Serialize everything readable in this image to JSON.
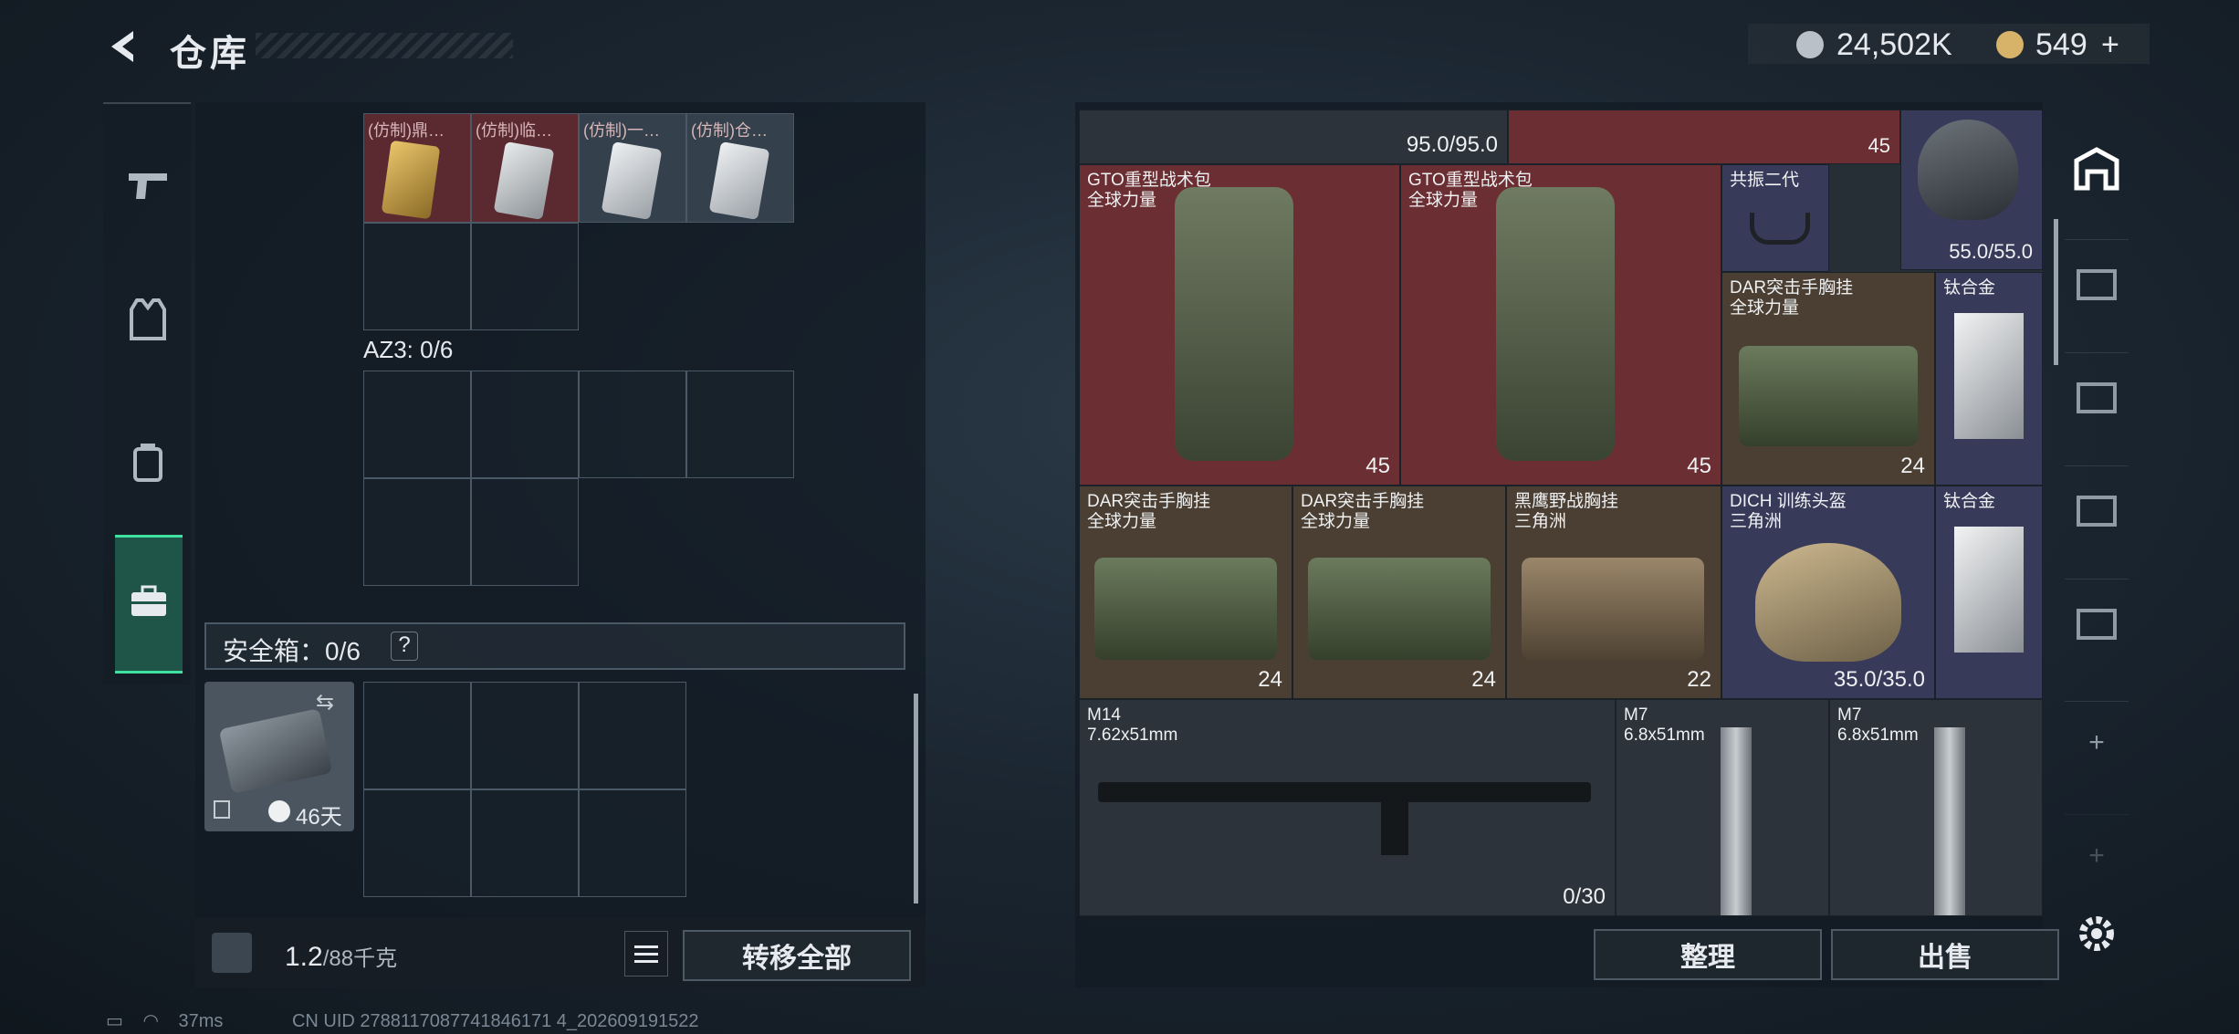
{
  "header": {
    "title": "仓库",
    "currency_silver": "24,502K",
    "currency_gold": "549",
    "gold_plus": "+"
  },
  "left_tabs": [
    "pistol-icon",
    "armor-vest-icon",
    "backpack-icon",
    "briefcase-icon"
  ],
  "left": {
    "items": [
      {
        "label": "(仿制)鼎…"
      },
      {
        "label": "(仿制)临…"
      },
      {
        "label": "(仿制)一…"
      },
      {
        "label": "(仿制)仓…"
      }
    ],
    "az3_label": "AZ3: 0/6",
    "safe_label": "安全箱：0/6",
    "help": "?",
    "safe_days": "46天",
    "weight": "1.2",
    "weight_unit": "/88千克",
    "transfer_all": "转移全部"
  },
  "grid": {
    "row0": {
      "val": "95.0/95.0",
      "badge": "45"
    },
    "helmet_top": {
      "val": "55.0/55.0"
    },
    "items": [
      {
        "name": "GTO重型战术包",
        "sub": "全球力量",
        "val": "45"
      },
      {
        "name": "GTO重型战术包",
        "sub": "全球力量",
        "val": "45"
      },
      {
        "name": "共振二代",
        "sub": ""
      },
      {
        "name": "DAR突击手胸挂",
        "sub": "全球力量",
        "val": "24"
      },
      {
        "name": "钛合金",
        "sub": ""
      },
      {
        "name": "DAR突击手胸挂",
        "sub": "全球力量",
        "val": "24"
      },
      {
        "name": "DAR突击手胸挂",
        "sub": "全球力量",
        "val": "24"
      },
      {
        "name": "黑鹰野战胸挂",
        "sub": "三角洲",
        "val": "22"
      },
      {
        "name": "DICH 训练头盔",
        "sub": "三角洲",
        "val": "35.0/35.0"
      },
      {
        "name": "钛合金",
        "sub": ""
      },
      {
        "name": "M14",
        "sub": "7.62x51mm",
        "val": "0/30"
      },
      {
        "name": "M7",
        "sub": "6.8x51mm"
      },
      {
        "name": "M7",
        "sub": "6.8x51mm"
      }
    ],
    "organize": "整理",
    "sell": "出售"
  },
  "right_tabs": [
    "storage-icon",
    "stash-iv-icon",
    "stash-iv-icon",
    "stash-v-icon",
    "stash-iv-icon",
    "+",
    "+",
    "settings-icon"
  ],
  "status": {
    "ping": "37ms",
    "uid": "CN UID 2788117087741846171 4_202609191522"
  },
  "colors": {
    "accent": "#40e0a0",
    "red_rarity": "#6b2f33",
    "gold_rarity": "#4b3f33",
    "purple_rarity": "#383a5a"
  }
}
